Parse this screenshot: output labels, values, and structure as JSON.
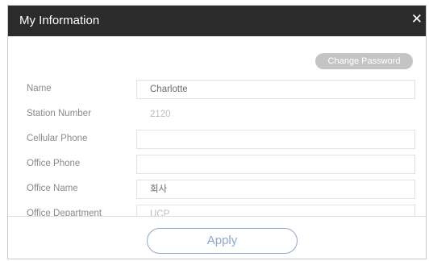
{
  "dialog": {
    "title": "My Information",
    "close_icon": "close-icon",
    "close_glyph": "✕",
    "change_password_label": "Change Password",
    "apply_label": "Apply"
  },
  "form": {
    "rows": [
      {
        "label": "Name",
        "value": "Charlotte",
        "readonly": false
      },
      {
        "label": "Station Number",
        "value": "2120",
        "readonly": true
      },
      {
        "label": "Cellular Phone",
        "value": "",
        "readonly": false
      },
      {
        "label": "Office Phone",
        "value": "",
        "readonly": false
      },
      {
        "label": "Office Name",
        "value": "회사",
        "readonly": false
      },
      {
        "label": "Office Department",
        "value": "UCP",
        "readonly": true
      }
    ]
  },
  "colors": {
    "titlebar": "#2b2b2b",
    "label_text": "#8a8a8a",
    "change_password_bg": "#c4c4c4",
    "apply_accent": "#8ea6cf"
  }
}
